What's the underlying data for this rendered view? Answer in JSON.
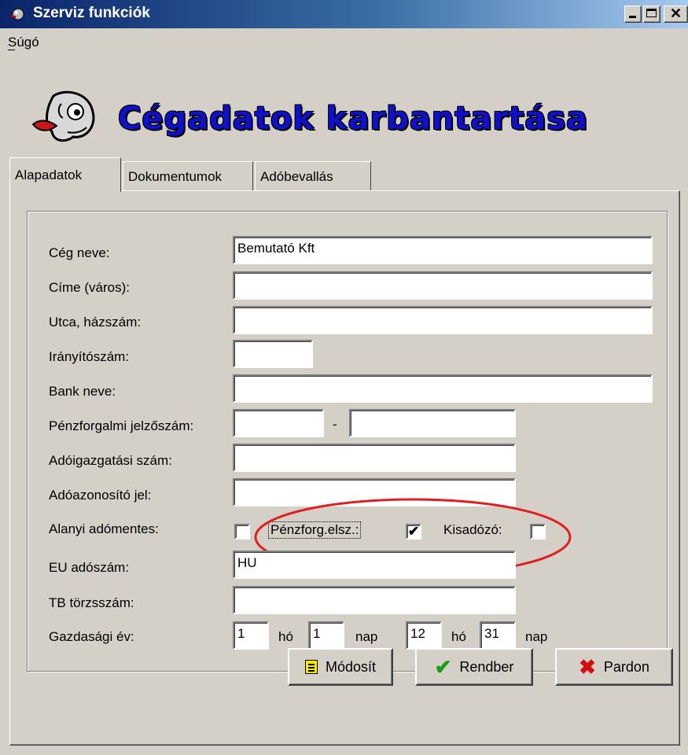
{
  "window": {
    "title": "Szerviz funkciók"
  },
  "menu": {
    "items": [
      {
        "label": "Súgó"
      }
    ]
  },
  "header": {
    "title": "Cégadatok karbantartása"
  },
  "tabs": [
    {
      "label": "Alapadatok",
      "active": true
    },
    {
      "label": "Dokumentumok",
      "active": false
    },
    {
      "label": "Adóbevallás",
      "active": false
    }
  ],
  "form": {
    "company_name": {
      "label": "Cég neve:",
      "value": "Bemutató Kft"
    },
    "city": {
      "label": "Címe (város):",
      "value": ""
    },
    "street": {
      "label": "Utca, házszám:",
      "value": ""
    },
    "zip": {
      "label": "Irányítószám:",
      "value": ""
    },
    "bank_name": {
      "label": "Bank neve:",
      "value": ""
    },
    "account": {
      "label": "Pénzforgalmi jelzőszám:",
      "value1": "",
      "separator": "-",
      "value2": ""
    },
    "tax_office": {
      "label": "Adóigazgatási szám:",
      "value": ""
    },
    "tax_id": {
      "label": "Adóazonosító jel:",
      "value": ""
    },
    "checkboxes": {
      "vat_exempt": {
        "label": "Alanyi adómentes:",
        "checked": false
      },
      "cash_accounting": {
        "label": "Pénzforg.elsz.:",
        "checked": true,
        "mark": "✔"
      },
      "small_taxpayer": {
        "label": "Kisadózó:",
        "checked": false
      }
    },
    "eu_vat": {
      "label": "EU adószám:",
      "value": "HU"
    },
    "tb": {
      "label": "TB törzsszám:",
      "value": ""
    },
    "fiscal_year": {
      "label": "Gazdasági év:",
      "start_month": "1",
      "month_label": "hó",
      "start_day": "1",
      "day_label": "nap",
      "end_month": "12",
      "end_month_label": "hó",
      "end_day": "31",
      "end_day_label": "nap"
    }
  },
  "buttons": {
    "modify": {
      "label": "Módosít",
      "icon": "document-icon"
    },
    "ok": {
      "label": "Rendber",
      "icon": "checkmark-icon"
    },
    "cancel": {
      "label": "Pardon",
      "icon": "x-icon"
    }
  },
  "colors": {
    "titlebar": "#0a246a",
    "heading": "#1010c8",
    "annotation": "#e02020",
    "face": "#d4d0c8"
  }
}
